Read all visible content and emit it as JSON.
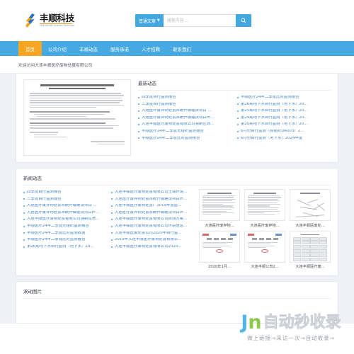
{
  "site": {
    "logo_cn": "丰顺科技",
    "logo_en": "FENGSHUN Science Technolo",
    "welcome": "欢迎访问大连丰顺医疗废物处置有限公司"
  },
  "search": {
    "type_label": "普通文章",
    "placeholder": "搜索内容...",
    "caret_icon": "chevron-down-icon",
    "button_icon": "search-icon"
  },
  "nav": {
    "items": [
      {
        "label": "首页",
        "active": true
      },
      {
        "label": "公司介绍",
        "active": false
      },
      {
        "label": "丰顺动态",
        "active": false
      },
      {
        "label": "服务承诺",
        "active": false
      },
      {
        "label": "人才招聘",
        "active": false
      },
      {
        "label": "联系我们",
        "active": false
      }
    ]
  },
  "doc_preview": {
    "title_line1": "大连医疗废弃物处置系统升级建设项目",
    "title_line2": "环境影响报告书 申请招标公示"
  },
  "latest": {
    "title": "最新动态",
    "col_left": [
      "四季度自行监测报告",
      "三季度自行监测报告",
      "大连医疗废弃物处置系统升级建设项目 ...",
      "大连医疗废弃物处置系统升级建设项目环...",
      "大连丰顺医疗废物处置有限公司强制性清...",
      "丰顺医疗24年二季度无组织监测报告",
      "丰顺医疗24年二季度比对监测报告"
    ],
    "col_right": [
      "丰顺医疗24年二季度比对监测报告",
      "第26期地下水自行监测（地下水）20...",
      "第25期地下水自行监测（地下水）20...",
      "第24期地下水自行监测（地下水）20...",
      "第20期地下水自行监测（地下水）20...",
      "6月份自行监测（有组织DA003）2...",
      "6月份自行监测（地下水）2024年度"
    ]
  },
  "news": {
    "title": "新闻动态",
    "col_left": [
      "四季度自行监测报告",
      "三季度自行监测报告",
      "大连医疗废弃物处置系统升级建设项目 ...",
      "大连医疗废弃物处置系统升级建设项目环...",
      "大连丰顺医疗废物处置有限公司强制性清...",
      "丰顺医疗24年二季度无组织监测报告",
      "丰顺医疗24年二季度比对监测数据",
      "丰顺医疗24年二季度比对监测报告",
      "第26期地下水自行监测（地下水）20..."
    ],
    "col_right": [
      "大连丰顺医疗废物处置有限公司土壤环境...",
      "大连医疗废弃物处置系统升级建设项目环...",
      "大连丰顺医疗废物处置厂2019年度监...",
      "大连医疗废弃物处置系统升级建设项目环...",
      "大连丰顺医疗废物处置有限公司自测方案...",
      "大连丰顺医疗废物处置有限公司环境信息...",
      "大连丰顺医废处置公司2020年自行监...",
      "2019年大连丰顺医疗废物处置有限公...",
      "大连丰顺医疗废物处置有限公司2020..."
    ],
    "thumbs": [
      {
        "caption": "大连医疗废弃物...",
        "kind": "doc"
      },
      {
        "caption": "大连医疗废弃物...",
        "kind": "doc"
      },
      {
        "caption": "大连丰顺医废处...",
        "kind": "map"
      },
      {
        "caption": "2020年1月...",
        "kind": "form-red"
      },
      {
        "caption": "大连丰顺公司2...",
        "kind": "form-blue"
      },
      {
        "caption": "大连丰顺医疗废...",
        "kind": "table"
      }
    ]
  },
  "scroll_section": {
    "title": "滚动图片"
  },
  "watermark": {
    "mark_j": "J",
    "mark_n": "n",
    "text": "自动秒收录",
    "tagline": "做上链接→来访一次→自动收录→"
  },
  "colors": {
    "brand_blue": "#46a9e2",
    "accent_orange": "#f5a623",
    "link_blue": "#3a7fc1",
    "page_bg": "#eef1f5"
  }
}
